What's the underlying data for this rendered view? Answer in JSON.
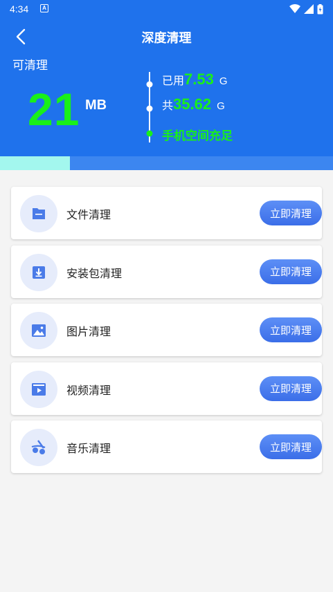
{
  "status_bar": {
    "time": "4:34",
    "notification_icon": "A"
  },
  "header": {
    "title": "深度清理",
    "clean_label": "可清理",
    "cleanable_amount": "21",
    "cleanable_unit": "MB",
    "used_label": "已用",
    "used_value": "7.53",
    "used_unit": "G",
    "total_label": "共",
    "total_value": "35.62",
    "total_unit": "G",
    "storage_status": "手机空间充足"
  },
  "progress": {
    "fraction": 0.21,
    "fill_color": "#a3f7ee",
    "track_color": "#3c86f0"
  },
  "colors": {
    "header_bg": "#1f72ec",
    "accent_green": "#19f019",
    "button_blue": "#3b6ee8"
  },
  "items": [
    {
      "icon": "folder-icon",
      "label": "文件清理",
      "button": "立即清理"
    },
    {
      "icon": "download-package-icon",
      "label": "安装包清理",
      "button": "立即清理"
    },
    {
      "icon": "image-icon",
      "label": "图片清理",
      "button": "立即清理"
    },
    {
      "icon": "video-icon",
      "label": "视频清理",
      "button": "立即清理"
    },
    {
      "icon": "music-icon",
      "label": "音乐清理",
      "button": "立即清理"
    }
  ]
}
